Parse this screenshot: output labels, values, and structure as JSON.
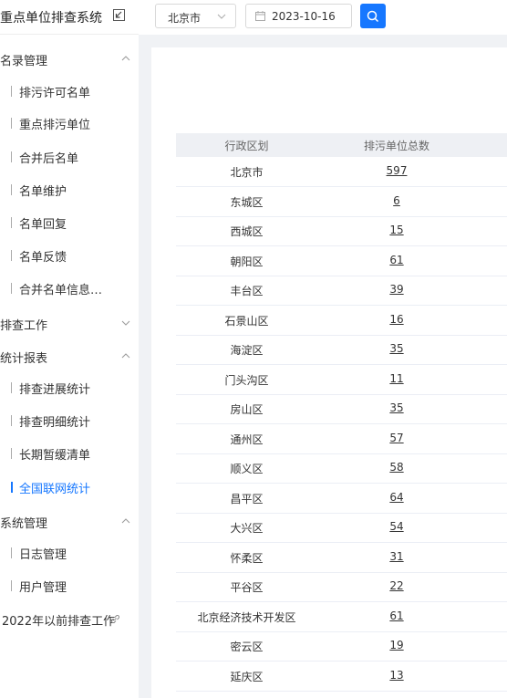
{
  "sidebar": {
    "title": "重点单位排查系统",
    "groups": [
      {
        "label": "名录管理",
        "expanded": true
      },
      {
        "label": "排查工作",
        "expanded": false
      },
      {
        "label": "统计报表",
        "expanded": true
      },
      {
        "label": "系统管理",
        "expanded": true
      }
    ],
    "items": [
      "排污许可名单",
      "重点排污单位",
      "合并后名单",
      "名单维护",
      "名单回复",
      "名单反馈",
      "合并名单信息…",
      "排查进展统计",
      "排查明细统计",
      "长期暂缓清单",
      "全国联网统计",
      "日志管理",
      "用户管理"
    ],
    "active_item": "全国联网统计",
    "external_link": "2022年以前排查工作"
  },
  "filters": {
    "region": "北京市",
    "date": "2023-10-16"
  },
  "table": {
    "headers": [
      "行政区划",
      "排污单位总数"
    ],
    "rows": [
      {
        "region": "北京市",
        "count": "597"
      },
      {
        "region": "东城区",
        "count": "6"
      },
      {
        "region": "西城区",
        "count": "15"
      },
      {
        "region": "朝阳区",
        "count": "61"
      },
      {
        "region": "丰台区",
        "count": "39"
      },
      {
        "region": "石景山区",
        "count": "16"
      },
      {
        "region": "海淀区",
        "count": "35"
      },
      {
        "region": "门头沟区",
        "count": "11"
      },
      {
        "region": "房山区",
        "count": "35"
      },
      {
        "region": "通州区",
        "count": "57"
      },
      {
        "region": "顺义区",
        "count": "58"
      },
      {
        "region": "昌平区",
        "count": "64"
      },
      {
        "region": "大兴区",
        "count": "54"
      },
      {
        "region": "怀柔区",
        "count": "31"
      },
      {
        "region": "平谷区",
        "count": "22"
      },
      {
        "region": "北京经济技术开发区",
        "count": "61"
      },
      {
        "region": "密云区",
        "count": "19"
      },
      {
        "region": "延庆区",
        "count": "13"
      }
    ]
  },
  "colors": {
    "accent": "#1677ff"
  }
}
